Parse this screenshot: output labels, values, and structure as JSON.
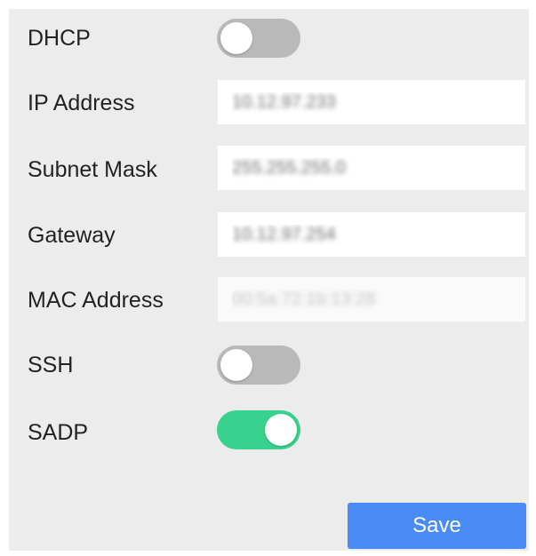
{
  "network": {
    "dhcp": {
      "label": "DHCP",
      "enabled": false
    },
    "ip_address": {
      "label": "IP Address",
      "value": "10.12.97.233"
    },
    "subnet_mask": {
      "label": "Subnet Mask",
      "value": "255.255.255.0"
    },
    "gateway": {
      "label": "Gateway",
      "value": "10.12.97.254"
    },
    "mac_address": {
      "label": "MAC Address",
      "value": "00:5a:72:1b:13:28"
    },
    "ssh": {
      "label": "SSH",
      "enabled": false
    },
    "sadp": {
      "label": "SADP",
      "enabled": true
    }
  },
  "actions": {
    "save_label": "Save"
  },
  "colors": {
    "panel_bg": "#ececed",
    "toggle_on": "#37d28d",
    "toggle_off": "#b9b9b9",
    "save_button": "#4a8cf5"
  }
}
